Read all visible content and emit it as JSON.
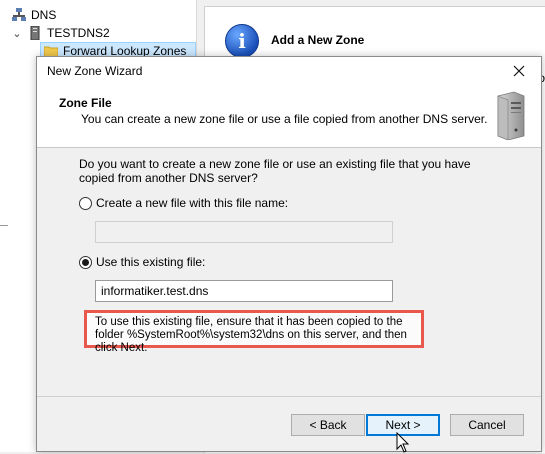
{
  "tree": {
    "root_label": "DNS",
    "server_label": "TESTDNS2",
    "zones_label": "Forward Lookup Zones"
  },
  "background_pane": {
    "title": "Add a New Zone",
    "overflow_text": "to"
  },
  "wizard": {
    "window_title": "New Zone Wizard",
    "header_title": "Zone File",
    "header_description": "You can create a new zone file or use a file copied from another DNS server.",
    "question": "Do you want to create a new zone file or use an existing file that you have copied from another DNS server?",
    "options": [
      {
        "label": "Create a new file with this file name:",
        "selected": false,
        "value": ""
      },
      {
        "label": "Use this existing file:",
        "selected": true,
        "value": "informatiker.test.dns"
      }
    ],
    "note": "To use this existing file, ensure that it has been copied to the folder %SystemRoot%\\system32\\dns on this server, and then click Next.",
    "buttons": {
      "back": "< Back",
      "next": "Next >",
      "cancel": "Cancel"
    }
  },
  "colors": {
    "highlight_border": "#e8584c",
    "default_button": "#0078d7",
    "tree_selection": "#cce8ff"
  },
  "icons": [
    "dns-icon",
    "server-icon",
    "folder-icon",
    "info-icon",
    "close-icon",
    "server-tower-icon",
    "cursor-icon"
  ]
}
